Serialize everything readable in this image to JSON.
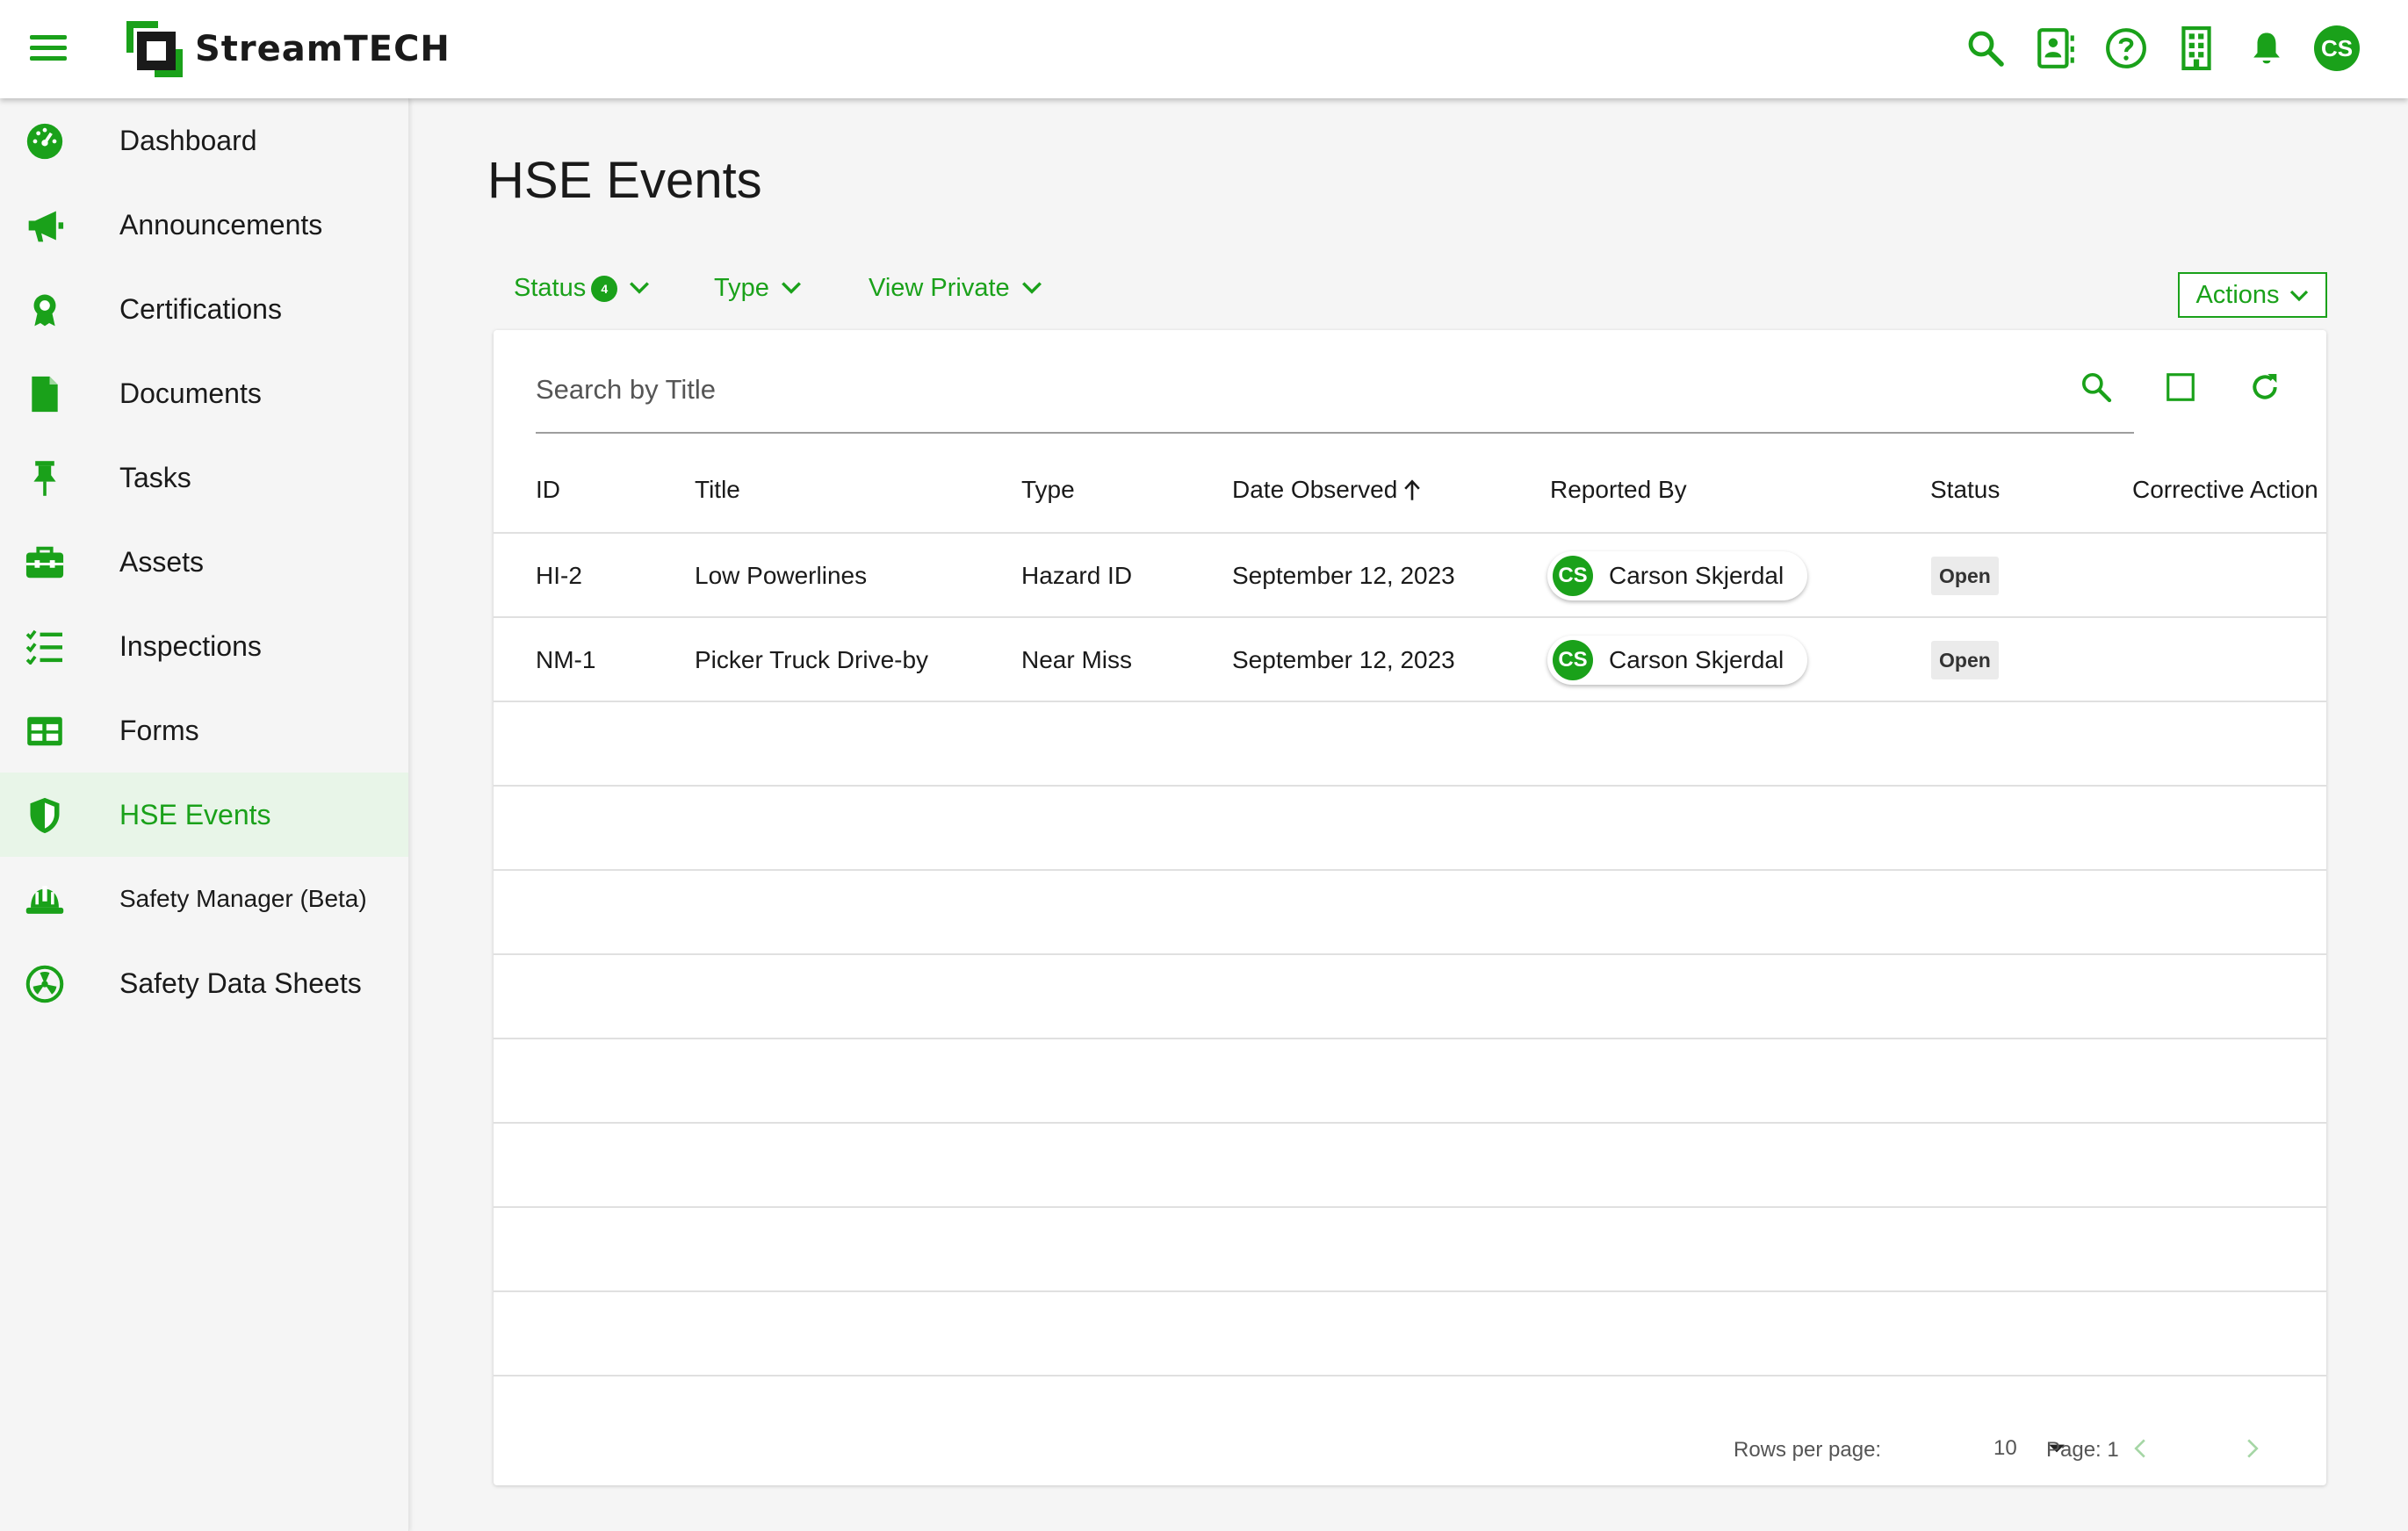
{
  "app": {
    "brand_name": "StreamTECH",
    "brand_color": "#1aa11a",
    "user_initials": "CS"
  },
  "topbar": {
    "icons": [
      "search-icon",
      "contact-card-icon",
      "help-icon",
      "building-icon",
      "bell-icon",
      "user-avatar"
    ]
  },
  "sidebar": {
    "items": [
      {
        "label": "Dashboard",
        "icon": "speedometer-icon"
      },
      {
        "label": "Announcements",
        "icon": "megaphone-icon"
      },
      {
        "label": "Certifications",
        "icon": "ribbon-icon"
      },
      {
        "label": "Documents",
        "icon": "document-icon"
      },
      {
        "label": "Tasks",
        "icon": "pin-icon"
      },
      {
        "label": "Assets",
        "icon": "toolbox-icon"
      },
      {
        "label": "Inspections",
        "icon": "checklist-icon"
      },
      {
        "label": "Forms",
        "icon": "table-icon"
      },
      {
        "label": "HSE Events",
        "icon": "shield-icon",
        "active": true
      },
      {
        "label": "Safety Manager (Beta)",
        "icon": "hardhat-icon"
      },
      {
        "label": "Safety Data Sheets",
        "icon": "hazard-icon"
      }
    ]
  },
  "main": {
    "title": "HSE Events",
    "filters": {
      "status_label": "Status",
      "status_count": "4",
      "type_label": "Type",
      "private_label": "View Private"
    },
    "actions_label": "Actions",
    "search": {
      "placeholder": "Search by Title"
    },
    "table": {
      "headers": {
        "id": "ID",
        "title": "Title",
        "type": "Type",
        "date": "Date Observed",
        "reported": "Reported By",
        "status": "Status",
        "corrective": "Corrective Action"
      },
      "rows": [
        {
          "id": "HI-2",
          "title": "Low Powerlines",
          "type": "Hazard ID",
          "date": "September 12, 2023",
          "initials": "CS",
          "reporter": "Carson Skjerdal",
          "status": "Open"
        },
        {
          "id": "NM-1",
          "title": "Picker Truck Drive-by",
          "type": "Near Miss",
          "date": "September 12, 2023",
          "initials": "CS",
          "reporter": "Carson Skjerdal",
          "status": "Open"
        }
      ]
    },
    "pagination": {
      "rows_per_page_label": "Rows per page:",
      "rows_per_page": "10",
      "page_label": "Page: 1"
    }
  }
}
